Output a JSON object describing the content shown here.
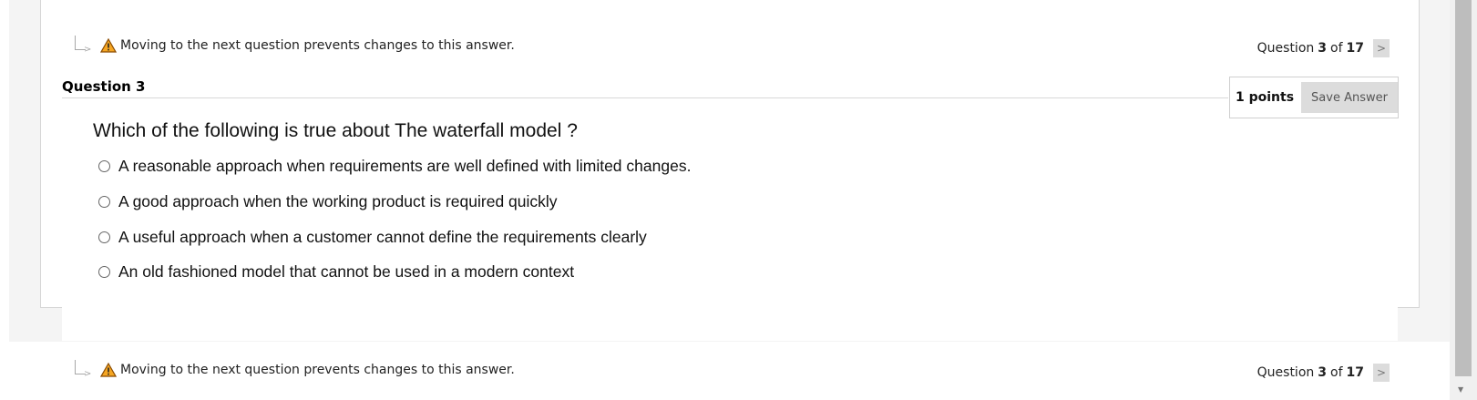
{
  "warning": {
    "text": "Moving to the next question prevents changes to this answer."
  },
  "nav": {
    "question_word": "Question",
    "current": "3",
    "of_word": "of",
    "total": "17",
    "next_glyph": ">"
  },
  "question": {
    "title": "Question 3",
    "points": "1 points",
    "save_label": "Save Answer",
    "text": "Which of the following is true about The waterfall model ?",
    "options": [
      "A reasonable approach when requirements are well defined with limited changes.",
      "A good approach when the working product is required quickly",
      "A useful approach when a customer cannot define the requirements clearly",
      "An old fashioned model that cannot be used in a modern context"
    ]
  },
  "icons": {
    "warning": "warning-triangle-icon",
    "indent_arrow": "indent-arrow-icon",
    "next": "chevron-right-icon",
    "radio": "radio-button"
  },
  "colors": {
    "warning_fill": "#f5a623",
    "button_gray": "#dcdcdc"
  }
}
